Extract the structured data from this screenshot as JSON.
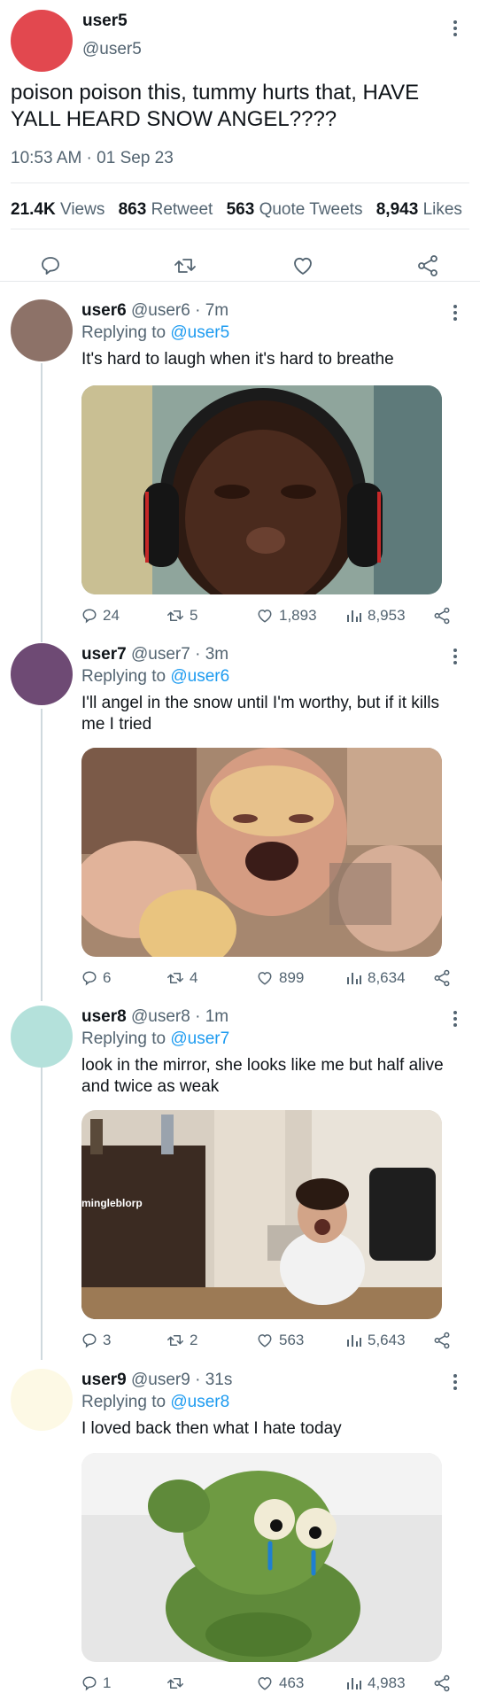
{
  "colors": {
    "accent": "#1d9bf0",
    "text": "#0f1419",
    "secondary": "#536471",
    "divider": "#e6e9eb",
    "thread_line": "#cfd9de",
    "avatar_user5": "#e2484f",
    "avatar_user6": "#8d7268",
    "avatar_user7": "#6e4a74",
    "avatar_user8": "#b4e1db",
    "avatar_user9": "#fdf9e5"
  },
  "main_tweet": {
    "display_name": "user5",
    "handle": "@user5",
    "text": "poison poison this, tummy hurts that, HAVE YALL HEARD SNOW ANGEL????",
    "timestamp": "10:53 AM · 01 Sep 23",
    "stats": {
      "views_count": "21.4K",
      "views_label": "Views",
      "retweets_count": "863",
      "retweets_label": "Retweet",
      "quotes_count": "563",
      "quotes_label": "Quote Tweets",
      "likes_count": "8,943",
      "likes_label": "Likes"
    },
    "icons": [
      "reply-icon",
      "retweet-icon",
      "like-icon",
      "share-icon"
    ]
  },
  "replies": [
    {
      "display_name": "user6",
      "handle": "@user6",
      "time": "7m",
      "replying_label": "Replying to",
      "replying_to": "@user5",
      "text": "It's hard to laugh when it's hard to breathe",
      "media": "photo: person crying while wearing headphones",
      "counts": {
        "replies": "24",
        "retweets": "5",
        "likes": "1,893",
        "views": "8,953"
      }
    },
    {
      "display_name": "user7",
      "handle": "@user7",
      "time": "3m",
      "replying_label": "Replying to",
      "replying_to": "@user6",
      "text": "I'll angel in the snow until I'm worthy, but if it kills me I tried",
      "media": "photo: collage of a woman crying",
      "counts": {
        "replies": "6",
        "retweets": "4",
        "likes": "899",
        "views": "8,634"
      }
    },
    {
      "display_name": "user8",
      "handle": "@user8",
      "time": "1m",
      "replying_label": "Replying to",
      "replying_to": "@user7",
      "text": "look in the mirror, she looks like me but half alive and twice as weak",
      "media": "photo: person screaming in a room",
      "media_watermark": "mingleblorp",
      "counts": {
        "replies": "3",
        "retweets": "2",
        "likes": "563",
        "views": "5,643"
      }
    },
    {
      "display_name": "user9",
      "handle": "@user9",
      "time": "31s",
      "replying_label": "Replying to",
      "replying_to": "@user8",
      "text": "I loved back then what I hate today",
      "media": "photo: crying green frog puppet",
      "counts": {
        "replies": "1",
        "retweets": "",
        "likes": "463",
        "views": "4,983"
      }
    }
  ]
}
